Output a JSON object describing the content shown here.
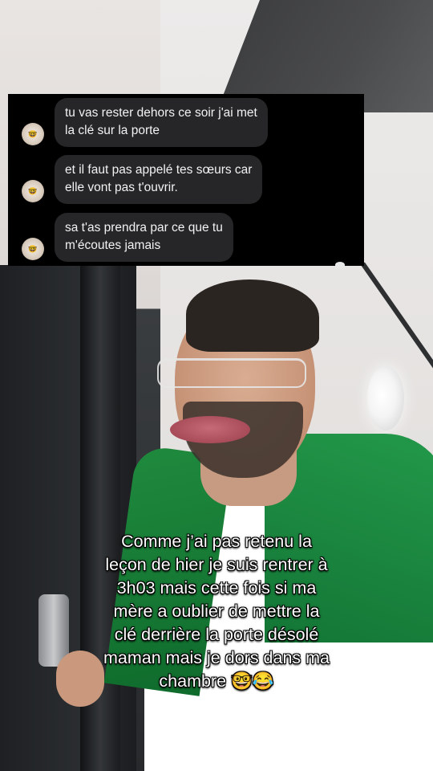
{
  "messages": [
    {
      "line1": "tu vas rester dehors ce soir j'ai met",
      "line2": "la clé sur la porte"
    },
    {
      "line1": "et il faut pas appelé tes sœurs car",
      "line2": "elle vont pas t'ouvrir."
    },
    {
      "line1": "sa t'as prendra par ce que tu",
      "line2": "m'écoutes jamais"
    }
  ],
  "caption": {
    "lines": [
      "Comme j’ai pas retenu la",
      "leçon de hier je suis rentrer à",
      "3h03 mais cette fois si ma",
      "mère a oublier de mettre la",
      "clé derrière la porte désolé",
      "maman mais je dors dans ma",
      "chambre 🤓😂"
    ]
  },
  "avatar_icon": "nerd-face-emoji",
  "colors": {
    "chat_background": "#000000",
    "bubble": "#262628",
    "bubble_text": "#f2f2f2",
    "caption_text": "#ffffff"
  }
}
